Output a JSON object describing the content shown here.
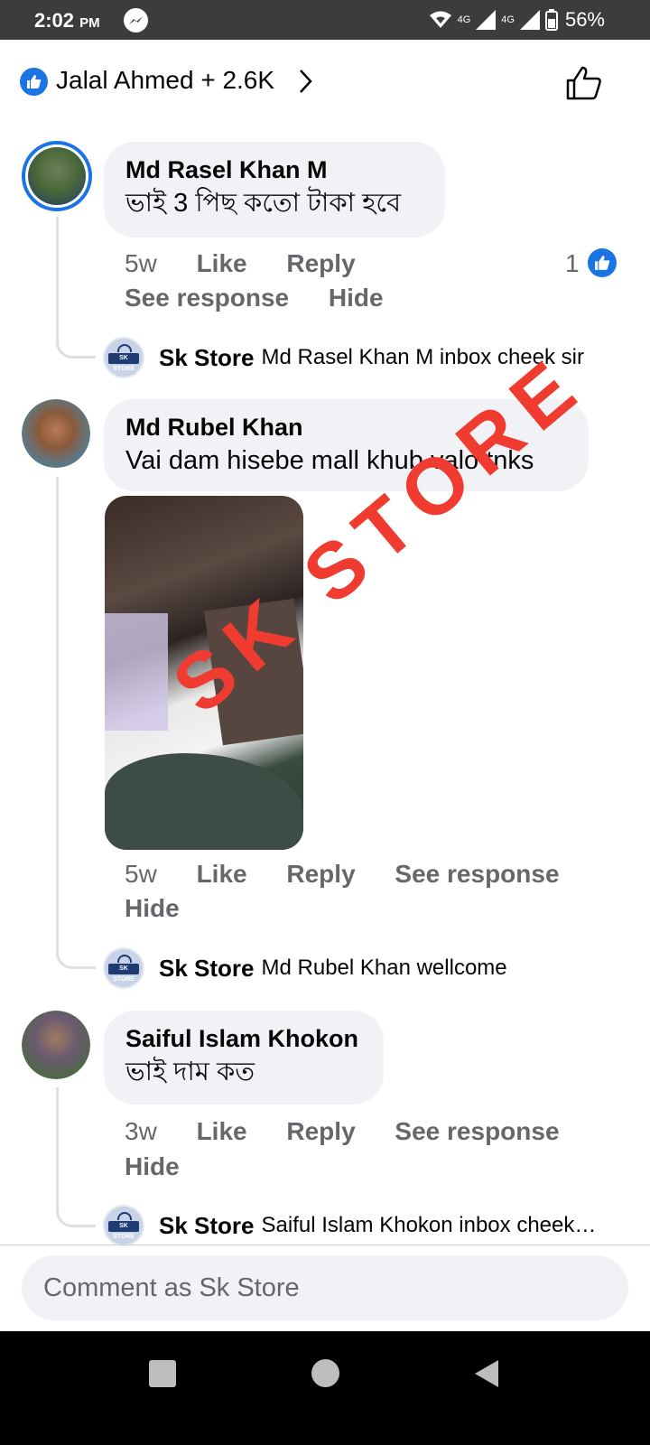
{
  "status_bar": {
    "time": "2:02",
    "ampm": "PM",
    "network_1": "4G",
    "network_2": "4G",
    "battery": "56%"
  },
  "header": {
    "reactors": "Jalal Ahmed + 2.6K",
    "icons": [
      "like-reaction-icon",
      "chevron-right-icon",
      "thumbs-up-outline-icon"
    ]
  },
  "comments": [
    {
      "author": "Md Rasel Khan M",
      "text": "ভাই 3 পিছ কতো টাকা হবে",
      "age": "5w",
      "like": "Like",
      "reply": "Reply",
      "see_response": "See response",
      "hide": "Hide",
      "like_count": "1",
      "reply_item": {
        "author": "Sk Store",
        "text": "Md Rasel Khan M inbox cheek sir"
      }
    },
    {
      "author": "Md Rubel Khan",
      "text": "Vai dam hisebe mall khub valo tnks",
      "age": "5w",
      "like": "Like",
      "reply": "Reply",
      "see_response": "See response",
      "hide": "Hide",
      "watermark": "SK STORE",
      "reply_item": {
        "author": "Sk Store",
        "text": "Md Rubel Khan wellcome"
      }
    },
    {
      "author": "Saiful Islam Khokon",
      "text": "ভাই দাম কত",
      "age": "3w",
      "like": "Like",
      "reply": "Reply",
      "see_response": "See response",
      "hide": "Hide",
      "reply_item": {
        "author": "Sk Store",
        "text": "Saiful Islam Khokon inbox cheek…"
      }
    }
  ],
  "composer": {
    "placeholder": "Comment as Sk Store"
  },
  "store_avatar_label": "SK STORE",
  "colors": {
    "accent": "#1b74e4",
    "bubble": "#f0f2f5",
    "watermark": "#ef3b30"
  }
}
